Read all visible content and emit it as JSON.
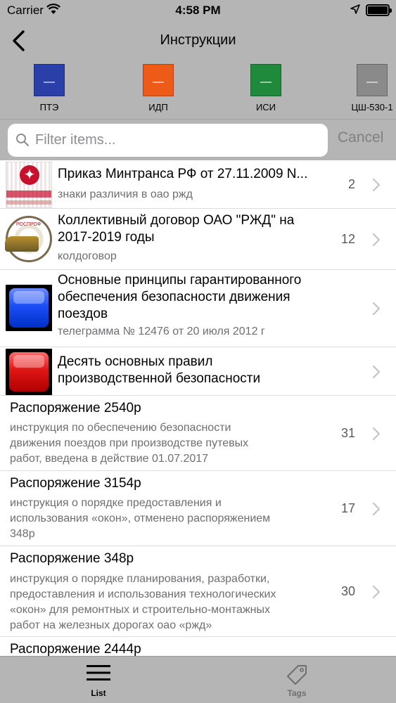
{
  "status_bar": {
    "carrier": "Carrier",
    "time": "4:58 PM",
    "battery_level": 1.0
  },
  "nav": {
    "title": "Инструкции"
  },
  "doc_strip": [
    {
      "label": "ПТЭ",
      "color": "#2a3fa8"
    },
    {
      "label": "ИДП",
      "color": "#ee5a17"
    },
    {
      "label": "ИСИ",
      "color": "#1f8a3c"
    },
    {
      "label": "ЦШ-530-1",
      "color": "#8a8a8a"
    }
  ],
  "search": {
    "placeholder": "Filter items...",
    "value": "",
    "cancel_label": "Cancel"
  },
  "list": [
    {
      "title_lines": [
        "Приказ Минтранса РФ от 27.11.2009 N..."
      ],
      "subtitle_lines": [
        "знаки различия в оао ржд"
      ],
      "count": "2",
      "thumb": "orders-emblem-icon"
    },
    {
      "title_lines": [
        "Коллективный договор ОАО \"РЖД\" на",
        "2017-2019 годы"
      ],
      "subtitle_lines": [
        "колдоговор"
      ],
      "count": "12",
      "thumb": "union-emblem-icon"
    },
    {
      "title_lines": [
        "Основные принципы гарантированного",
        "обеспечения безопасности движения",
        "поездов"
      ],
      "subtitle_lines": [
        "телеграмма № 12476 от 20 июля 2012 г"
      ],
      "count": "",
      "thumb": "blue-square-icon"
    },
    {
      "title_lines": [
        "Десять основных правил",
        "производственной безопасности"
      ],
      "subtitle_lines": [],
      "count": "",
      "thumb": "red-square-icon"
    },
    {
      "title_lines": [
        "Распоряжение 2540р"
      ],
      "subtitle_lines": [
        "инструкция  по обеспечению безопасности",
        "движения поездов  при производстве путевых",
        "работ, введена в действие 01.07.2017"
      ],
      "count": "31",
      "thumb": ""
    },
    {
      "title_lines": [
        "Распоряжение 3154р"
      ],
      "subtitle_lines": [
        "инструкция о порядке предоставления и",
        "использования «окон», отменено распоряжением",
        "348р"
      ],
      "count": "17",
      "thumb": ""
    },
    {
      "title_lines": [
        "Распоряжение 348р"
      ],
      "subtitle_lines": [
        "инструкция о порядке планирования, разработки,",
        "предоставления и использования технологических",
        "«окон» для ремонтных и строительно-монтажных",
        "работ на железных дорогах оао «ржд»"
      ],
      "count": "30",
      "thumb": ""
    },
    {
      "title_lines": [
        "Распоряжение 2444р"
      ],
      "subtitle_lines": [],
      "count": "",
      "thumb": ""
    }
  ],
  "tab_bar": [
    {
      "label": "List",
      "icon": "list-icon",
      "active": true
    },
    {
      "label": "Tags",
      "icon": "tag-icon",
      "active": false
    }
  ]
}
